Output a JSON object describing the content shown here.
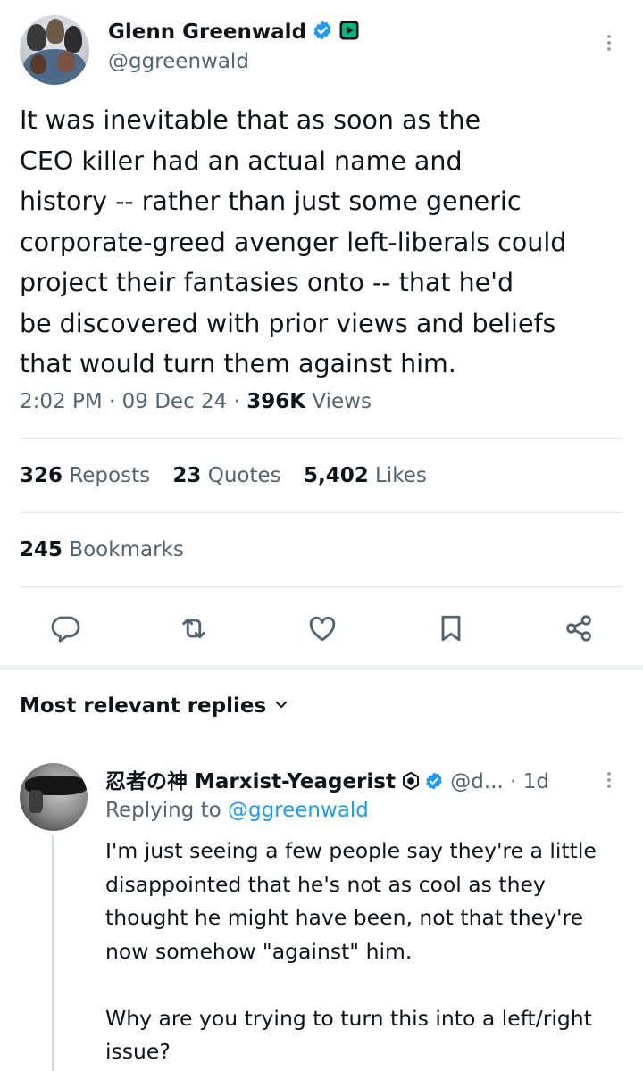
{
  "tweet": {
    "author_name": "Glenn Greenwald",
    "author_handle": "@ggreenwald",
    "text": "It was inevitable that as soon as the\nCEO killer had an actual name and\nhistory -- rather than just some generic\ncorporate-greed avenger left-liberals could\nproject their fantasies onto -- that he'd\nbe discovered with prior views and beliefs\nthat would turn them against him.",
    "time": "2:02 PM",
    "date": "09 Dec 24",
    "views_count": "396K",
    "views_label": "Views",
    "separator": "·"
  },
  "stats": {
    "reposts_count": "326",
    "reposts_label": "Reposts",
    "quotes_count": "23",
    "quotes_label": "Quotes",
    "likes_count": "5,402",
    "likes_label": "Likes",
    "bookmarks_count": "245",
    "bookmarks_label": "Bookmarks"
  },
  "actions": [
    "reply-icon",
    "repost-icon",
    "like-icon",
    "bookmark-icon",
    "share-icon"
  ],
  "replies": {
    "header": "Most relevant replies"
  },
  "reply": {
    "name": "忍者の神 Marxist-Yeagerist",
    "handle": "@d...",
    "time": "· 1d",
    "replying_prefix": "Replying to",
    "replying_to": "@ggreenwald",
    "text": "I'm just seeing a few people say they're a little\ndisappointed that he's not as cool as they\nthought he might have been, not that they're\nnow somehow \"against\" him.\n\nWhy are you trying to turn this into a left/right\nissue?"
  },
  "colors": {
    "accent": "#1d9bf0",
    "text": "#0f1419",
    "muted": "#536471",
    "badge_green": "#00ba7c"
  }
}
